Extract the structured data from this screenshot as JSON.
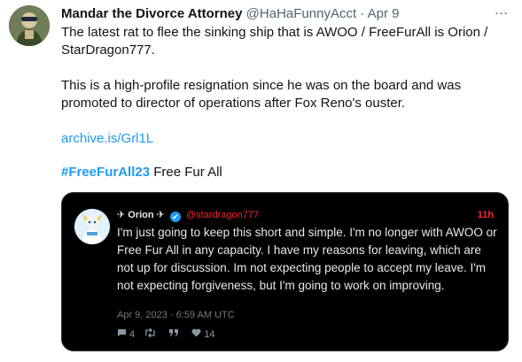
{
  "tweet": {
    "display_name": "Mandar the Divorce Attorney",
    "handle": "@HaHaFunnyAcct",
    "separator": "·",
    "date": "Apr 9",
    "more_icon": "…",
    "paragraph_1": "The latest rat to flee the sinking ship that is AWOO / FreeFurAll is Orion / StarDragon777.",
    "paragraph_2": "This is a high-profile resignation since he was on the board and was promoted to director of operations after Fox Reno's ouster.",
    "link": "archive.is/Grl1L",
    "hashtag": "#FreeFurAll23",
    "hashtag_suffix": "Free Fur All"
  },
  "embed": {
    "name": "✈ Orion ✈",
    "verified_icon": "✔",
    "handle": "@stardragon777",
    "time": "11h",
    "text": "I'm just going to keep this short and simple. I'm no longer with AWOO or Free Fur All in any capacity. I have my reasons for leaving, which are not up for discussion. Im not expecting people to accept my leave. I'm not expecting forgiveness, but I'm going to work on improving.",
    "date": "Apr 9, 2023 · 6:59 AM UTC",
    "replies_icon": "reply-icon",
    "replies": "4",
    "retweets_icon": "retweet-icon",
    "quotes_icon": "quote-icon",
    "likes_icon": "heart-icon",
    "likes": "14"
  },
  "colors": {
    "link": "#1d9bf0",
    "embed_bg": "#000000",
    "embed_handle": "#f4212e",
    "secondary_text": "#536471"
  }
}
